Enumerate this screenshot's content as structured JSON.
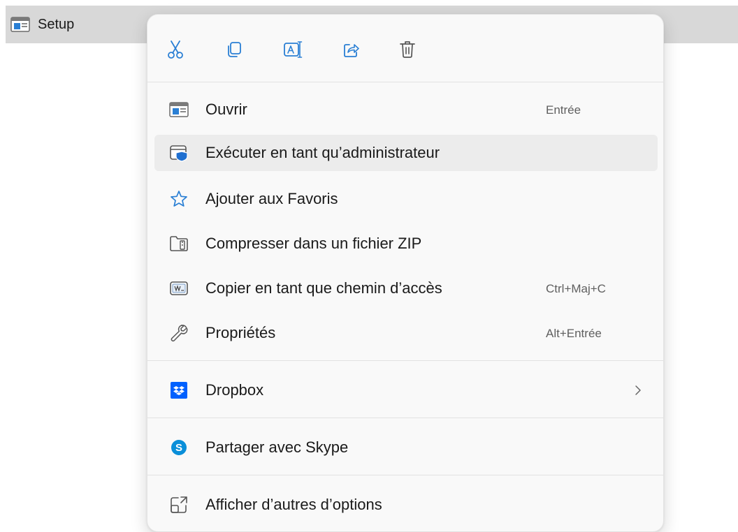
{
  "file": {
    "name": "Setup",
    "icon": "application-window-icon"
  },
  "menu": {
    "quick_actions": [
      {
        "name": "cut",
        "icon": "scissors-icon"
      },
      {
        "name": "copy",
        "icon": "copy-icon"
      },
      {
        "name": "rename",
        "icon": "rename-icon"
      },
      {
        "name": "share",
        "icon": "share-icon"
      },
      {
        "name": "delete",
        "icon": "trash-icon"
      }
    ],
    "items": [
      {
        "label": "Ouvrir",
        "shortcut": "Entrée",
        "icon": "open-window-icon"
      },
      {
        "label": "Exécuter en tant qu’administrateur",
        "shortcut": "",
        "icon": "run-as-admin-shield-icon",
        "highlighted": true
      },
      {
        "label": "Ajouter aux Favoris",
        "shortcut": "",
        "icon": "star-icon"
      },
      {
        "label": "Compresser dans un fichier ZIP",
        "shortcut": "",
        "icon": "zip-folder-icon"
      },
      {
        "label": "Copier en tant que chemin d’accès",
        "shortcut": "Ctrl+Maj+C",
        "icon": "copy-path-icon"
      },
      {
        "label": "Propriétés",
        "shortcut": "Alt+Entrée",
        "icon": "wrench-icon"
      },
      {
        "label": "Dropbox",
        "shortcut": "",
        "icon": "dropbox-icon",
        "submenu": true
      },
      {
        "label": "Partager avec Skype",
        "shortcut": "",
        "icon": "skype-icon"
      },
      {
        "label": "Afficher d’autres d’options",
        "shortcut": "",
        "icon": "expand-options-icon"
      }
    ]
  },
  "colors": {
    "accent": "#0067c0",
    "dropbox": "#0061fe",
    "skype": "#0a8fd9",
    "menu_bg": "#f9f9f9",
    "hover_bg": "#ececec"
  }
}
